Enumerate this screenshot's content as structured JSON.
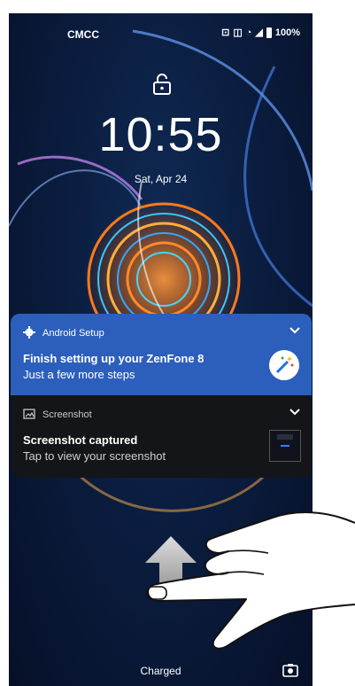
{
  "status_bar": {
    "carrier": "CMCC",
    "battery": "100%"
  },
  "lockscreen": {
    "time": "10:55",
    "date": "Sat, Apr 24",
    "bottom_status": "Charged"
  },
  "notifications": [
    {
      "app": "Android Setup",
      "title": "Finish setting up your ZenFone 8",
      "text": "Just a few more steps",
      "color": "#2c5fbb"
    },
    {
      "app": "Screenshot",
      "title": "Screenshot captured",
      "text": "Tap to view your screenshot",
      "color": "#141518"
    }
  ],
  "icons": [
    "lock-open-icon",
    "gear-icon",
    "chevron-down-icon",
    "magic-wand-icon",
    "image-icon",
    "camera-icon",
    "swipe-up-arrow-icon",
    "hand-gesture-icon"
  ]
}
